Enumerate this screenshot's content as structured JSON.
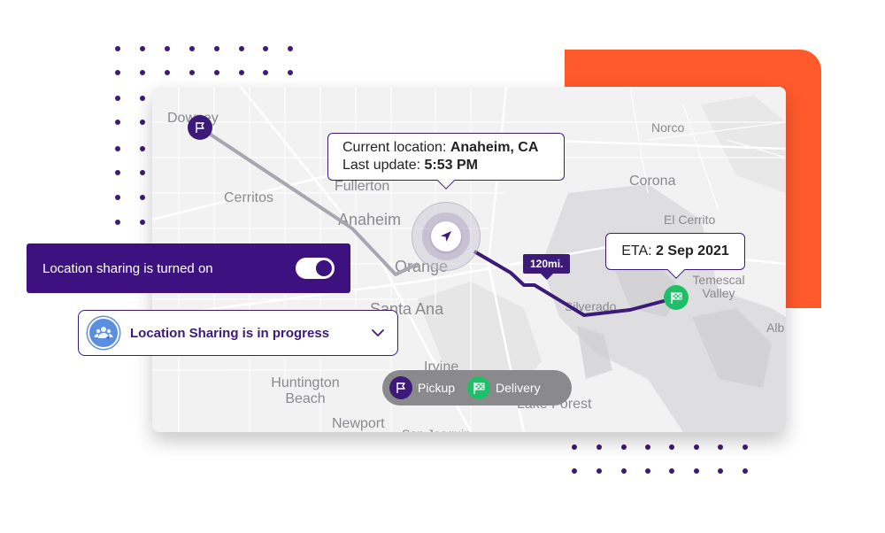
{
  "colors": {
    "brand_purple": "#3d1a78",
    "accent_orange": "#ff5a2c",
    "delivery_green": "#1fbf6a",
    "route_inactive": "#a8a6b0"
  },
  "map": {
    "places": [
      {
        "name": "Downey"
      },
      {
        "name": "Cerritos"
      },
      {
        "name": "Fullerton"
      },
      {
        "name": "Anaheim"
      },
      {
        "name": "Orange"
      },
      {
        "name": "Santa Ana"
      },
      {
        "name": "Irvine"
      },
      {
        "name": "Huntington Beach"
      },
      {
        "name": "Newport"
      },
      {
        "name": "San Joaquin"
      },
      {
        "name": "Lake Forest"
      },
      {
        "name": "Silverado"
      },
      {
        "name": "Norco"
      },
      {
        "name": "Corona"
      },
      {
        "name": "El Cerrito"
      },
      {
        "name": "Temescal Valley"
      },
      {
        "name": "Alb"
      }
    ],
    "pickup_pin": {
      "icon": "flag-icon"
    },
    "delivery_pin": {
      "icon": "checkered-flag-icon"
    },
    "current_marker": {
      "icon": "navigation-arrow-icon"
    },
    "distance_badge": "120mi."
  },
  "current_location_tooltip": {
    "location_label": "Current location: ",
    "location_value": "Anaheim, CA",
    "update_label": "Last update: ",
    "update_value": "5:53 PM"
  },
  "eta_tooltip": {
    "label": "ETA: ",
    "value": "2 Sep 2021"
  },
  "legend": {
    "pickup_label": "Pickup",
    "delivery_label": "Delivery"
  },
  "location_sharing": {
    "label": "Location sharing is turned on",
    "toggle_on": true
  },
  "progress_dropdown": {
    "label": "Location Sharing is in progress",
    "icon": "group-location-icon"
  }
}
